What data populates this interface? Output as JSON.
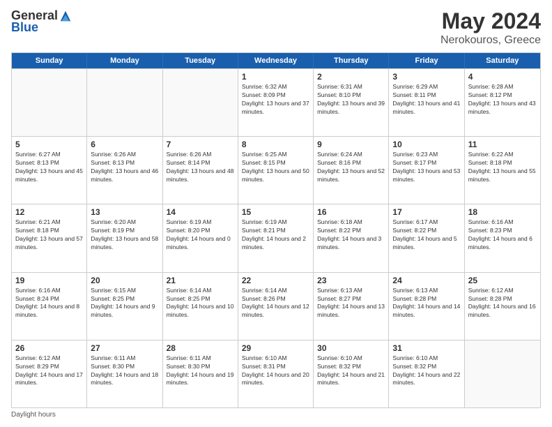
{
  "header": {
    "logo_general": "General",
    "logo_blue": "Blue",
    "month_title": "May 2024",
    "location": "Nerokouros, Greece"
  },
  "days_of_week": [
    "Sunday",
    "Monday",
    "Tuesday",
    "Wednesday",
    "Thursday",
    "Friday",
    "Saturday"
  ],
  "weeks": [
    [
      {
        "day": "",
        "sunrise": "",
        "sunset": "",
        "daylight": "",
        "empty": true
      },
      {
        "day": "",
        "sunrise": "",
        "sunset": "",
        "daylight": "",
        "empty": true
      },
      {
        "day": "",
        "sunrise": "",
        "sunset": "",
        "daylight": "",
        "empty": true
      },
      {
        "day": "1",
        "sunrise": "Sunrise: 6:32 AM",
        "sunset": "Sunset: 8:09 PM",
        "daylight": "Daylight: 13 hours and 37 minutes.",
        "empty": false
      },
      {
        "day": "2",
        "sunrise": "Sunrise: 6:31 AM",
        "sunset": "Sunset: 8:10 PM",
        "daylight": "Daylight: 13 hours and 39 minutes.",
        "empty": false
      },
      {
        "day": "3",
        "sunrise": "Sunrise: 6:29 AM",
        "sunset": "Sunset: 8:11 PM",
        "daylight": "Daylight: 13 hours and 41 minutes.",
        "empty": false
      },
      {
        "day": "4",
        "sunrise": "Sunrise: 6:28 AM",
        "sunset": "Sunset: 8:12 PM",
        "daylight": "Daylight: 13 hours and 43 minutes.",
        "empty": false
      }
    ],
    [
      {
        "day": "5",
        "sunrise": "Sunrise: 6:27 AM",
        "sunset": "Sunset: 8:13 PM",
        "daylight": "Daylight: 13 hours and 45 minutes.",
        "empty": false
      },
      {
        "day": "6",
        "sunrise": "Sunrise: 6:26 AM",
        "sunset": "Sunset: 8:13 PM",
        "daylight": "Daylight: 13 hours and 46 minutes.",
        "empty": false
      },
      {
        "day": "7",
        "sunrise": "Sunrise: 6:26 AM",
        "sunset": "Sunset: 8:14 PM",
        "daylight": "Daylight: 13 hours and 48 minutes.",
        "empty": false
      },
      {
        "day": "8",
        "sunrise": "Sunrise: 6:25 AM",
        "sunset": "Sunset: 8:15 PM",
        "daylight": "Daylight: 13 hours and 50 minutes.",
        "empty": false
      },
      {
        "day": "9",
        "sunrise": "Sunrise: 6:24 AM",
        "sunset": "Sunset: 8:16 PM",
        "daylight": "Daylight: 13 hours and 52 minutes.",
        "empty": false
      },
      {
        "day": "10",
        "sunrise": "Sunrise: 6:23 AM",
        "sunset": "Sunset: 8:17 PM",
        "daylight": "Daylight: 13 hours and 53 minutes.",
        "empty": false
      },
      {
        "day": "11",
        "sunrise": "Sunrise: 6:22 AM",
        "sunset": "Sunset: 8:18 PM",
        "daylight": "Daylight: 13 hours and 55 minutes.",
        "empty": false
      }
    ],
    [
      {
        "day": "12",
        "sunrise": "Sunrise: 6:21 AM",
        "sunset": "Sunset: 8:18 PM",
        "daylight": "Daylight: 13 hours and 57 minutes.",
        "empty": false
      },
      {
        "day": "13",
        "sunrise": "Sunrise: 6:20 AM",
        "sunset": "Sunset: 8:19 PM",
        "daylight": "Daylight: 13 hours and 58 minutes.",
        "empty": false
      },
      {
        "day": "14",
        "sunrise": "Sunrise: 6:19 AM",
        "sunset": "Sunset: 8:20 PM",
        "daylight": "Daylight: 14 hours and 0 minutes.",
        "empty": false
      },
      {
        "day": "15",
        "sunrise": "Sunrise: 6:19 AM",
        "sunset": "Sunset: 8:21 PM",
        "daylight": "Daylight: 14 hours and 2 minutes.",
        "empty": false
      },
      {
        "day": "16",
        "sunrise": "Sunrise: 6:18 AM",
        "sunset": "Sunset: 8:22 PM",
        "daylight": "Daylight: 14 hours and 3 minutes.",
        "empty": false
      },
      {
        "day": "17",
        "sunrise": "Sunrise: 6:17 AM",
        "sunset": "Sunset: 8:22 PM",
        "daylight": "Daylight: 14 hours and 5 minutes.",
        "empty": false
      },
      {
        "day": "18",
        "sunrise": "Sunrise: 6:16 AM",
        "sunset": "Sunset: 8:23 PM",
        "daylight": "Daylight: 14 hours and 6 minutes.",
        "empty": false
      }
    ],
    [
      {
        "day": "19",
        "sunrise": "Sunrise: 6:16 AM",
        "sunset": "Sunset: 8:24 PM",
        "daylight": "Daylight: 14 hours and 8 minutes.",
        "empty": false
      },
      {
        "day": "20",
        "sunrise": "Sunrise: 6:15 AM",
        "sunset": "Sunset: 8:25 PM",
        "daylight": "Daylight: 14 hours and 9 minutes.",
        "empty": false
      },
      {
        "day": "21",
        "sunrise": "Sunrise: 6:14 AM",
        "sunset": "Sunset: 8:25 PM",
        "daylight": "Daylight: 14 hours and 10 minutes.",
        "empty": false
      },
      {
        "day": "22",
        "sunrise": "Sunrise: 6:14 AM",
        "sunset": "Sunset: 8:26 PM",
        "daylight": "Daylight: 14 hours and 12 minutes.",
        "empty": false
      },
      {
        "day": "23",
        "sunrise": "Sunrise: 6:13 AM",
        "sunset": "Sunset: 8:27 PM",
        "daylight": "Daylight: 14 hours and 13 minutes.",
        "empty": false
      },
      {
        "day": "24",
        "sunrise": "Sunrise: 6:13 AM",
        "sunset": "Sunset: 8:28 PM",
        "daylight": "Daylight: 14 hours and 14 minutes.",
        "empty": false
      },
      {
        "day": "25",
        "sunrise": "Sunrise: 6:12 AM",
        "sunset": "Sunset: 8:28 PM",
        "daylight": "Daylight: 14 hours and 16 minutes.",
        "empty": false
      }
    ],
    [
      {
        "day": "26",
        "sunrise": "Sunrise: 6:12 AM",
        "sunset": "Sunset: 8:29 PM",
        "daylight": "Daylight: 14 hours and 17 minutes.",
        "empty": false
      },
      {
        "day": "27",
        "sunrise": "Sunrise: 6:11 AM",
        "sunset": "Sunset: 8:30 PM",
        "daylight": "Daylight: 14 hours and 18 minutes.",
        "empty": false
      },
      {
        "day": "28",
        "sunrise": "Sunrise: 6:11 AM",
        "sunset": "Sunset: 8:30 PM",
        "daylight": "Daylight: 14 hours and 19 minutes.",
        "empty": false
      },
      {
        "day": "29",
        "sunrise": "Sunrise: 6:10 AM",
        "sunset": "Sunset: 8:31 PM",
        "daylight": "Daylight: 14 hours and 20 minutes.",
        "empty": false
      },
      {
        "day": "30",
        "sunrise": "Sunrise: 6:10 AM",
        "sunset": "Sunset: 8:32 PM",
        "daylight": "Daylight: 14 hours and 21 minutes.",
        "empty": false
      },
      {
        "day": "31",
        "sunrise": "Sunrise: 6:10 AM",
        "sunset": "Sunset: 8:32 PM",
        "daylight": "Daylight: 14 hours and 22 minutes.",
        "empty": false
      },
      {
        "day": "",
        "sunrise": "",
        "sunset": "",
        "daylight": "",
        "empty": true
      }
    ]
  ],
  "footer": {
    "note": "Daylight hours"
  }
}
